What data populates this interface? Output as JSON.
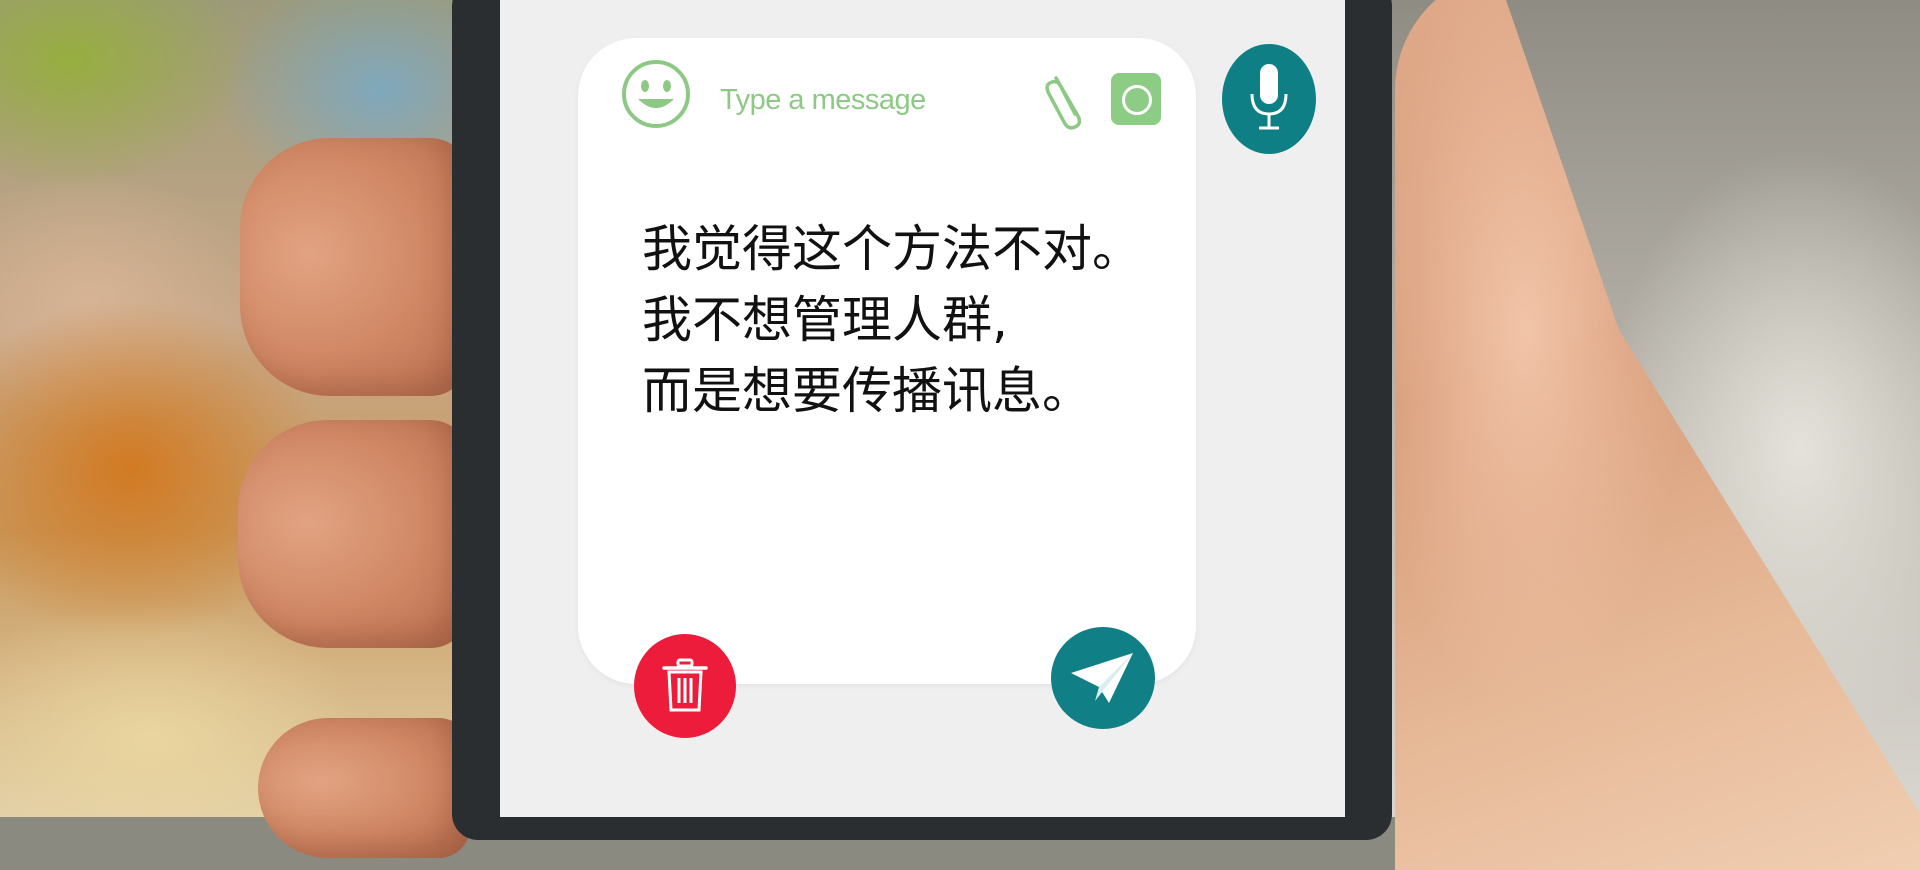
{
  "composer": {
    "placeholder": "Type a message",
    "message_lines": [
      "我觉得这个方法不对。",
      "我不想管理人群,",
      "而是想要传播讯息。"
    ]
  },
  "icons": {
    "emoji": "smiley-face-icon",
    "attach": "paperclip-icon",
    "camera": "camera-icon",
    "mic": "microphone-icon",
    "delete": "trash-icon",
    "send": "paper-plane-icon"
  },
  "colors": {
    "accent_green": "#8dc985",
    "teal_button": "#107f86",
    "delete_red": "#ee1c3b",
    "card_bg": "#ffffff",
    "screen_bg": "#efefef"
  }
}
